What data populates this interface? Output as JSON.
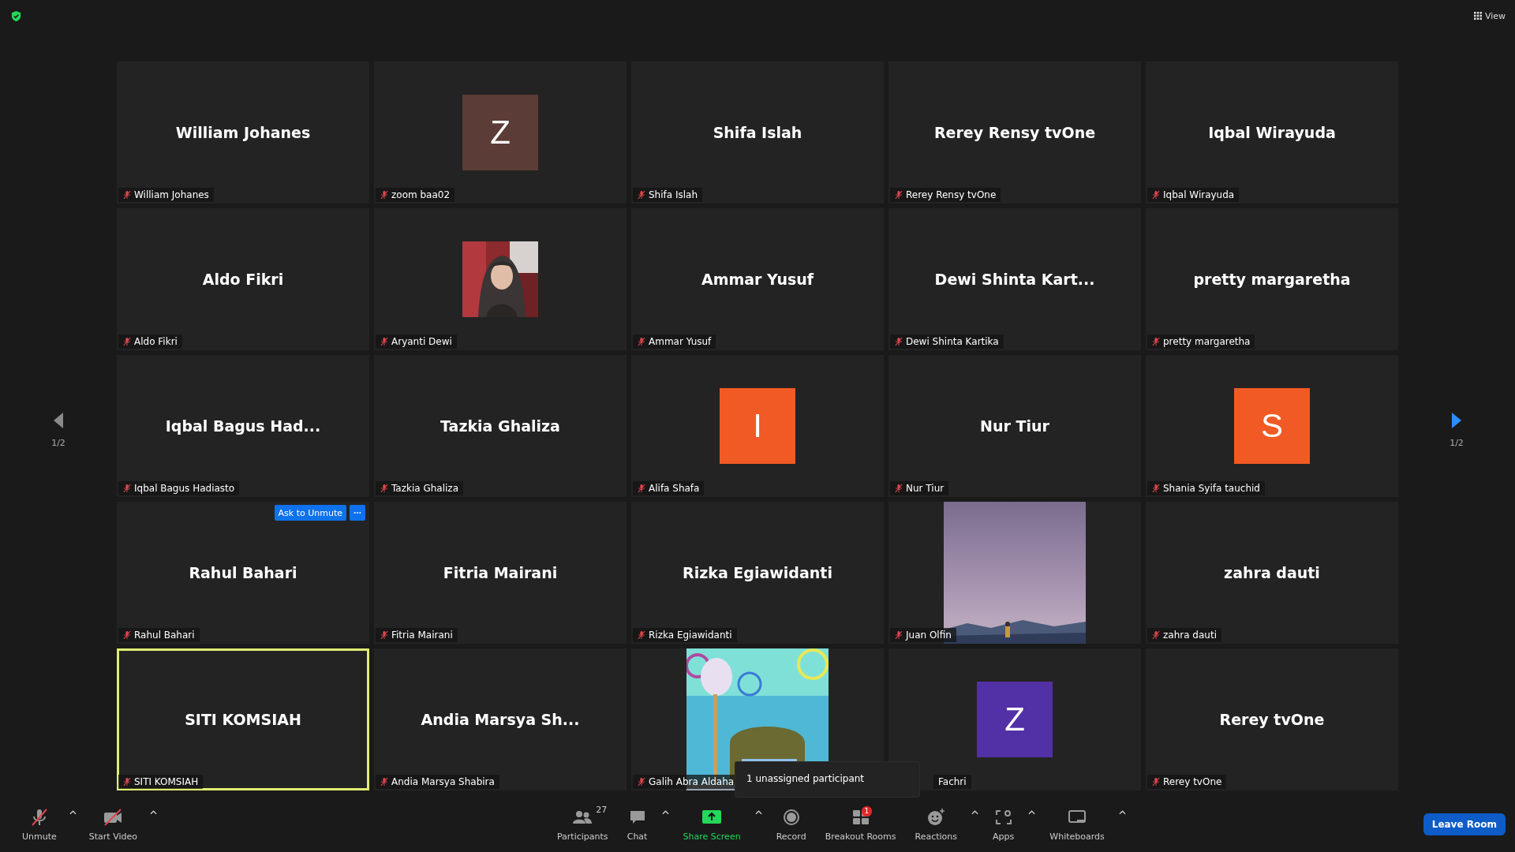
{
  "top_bar": {
    "view_label": "View"
  },
  "pager": {
    "prev": {
      "label": "1/2",
      "enabled": false
    },
    "next": {
      "label": "1/2",
      "enabled": true
    }
  },
  "tiles": [
    {
      "kind": "name",
      "title": "William Johanes",
      "tag": "William Johanes",
      "muted": true
    },
    {
      "kind": "avatar",
      "letter": "Z",
      "color": "#5c3c36",
      "tag": "zoom baa02",
      "muted": true
    },
    {
      "kind": "name",
      "title": "Shifa Islah",
      "tag": "Shifa Islah",
      "muted": true
    },
    {
      "kind": "name",
      "title": "Rerey Rensy tvOne",
      "tag": "Rerey Rensy tvOne",
      "muted": true
    },
    {
      "kind": "name",
      "title": "Iqbal Wirayuda",
      "tag": "Iqbal Wirayuda",
      "muted": true
    },
    {
      "kind": "name",
      "title": "Aldo Fikri",
      "tag": "Aldo Fikri",
      "muted": true
    },
    {
      "kind": "picture",
      "tag": "Aryanti Dewi",
      "muted": true
    },
    {
      "kind": "name",
      "title": "Ammar Yusuf",
      "tag": "Ammar Yusuf",
      "muted": true
    },
    {
      "kind": "name",
      "title": "Dewi Shinta Kart...",
      "tag": "Dewi Shinta Kartika",
      "muted": true
    },
    {
      "kind": "name",
      "title": "pretty margaretha",
      "tag": "pretty margaretha",
      "muted": true
    },
    {
      "kind": "name",
      "title": "Iqbal Bagus Had...",
      "tag": "Iqbal Bagus Hadiasto",
      "muted": true
    },
    {
      "kind": "name",
      "title": "Tazkia Ghaliza",
      "tag": "Tazkia Ghaliza",
      "muted": true
    },
    {
      "kind": "avatar",
      "letter": "I",
      "color": "#f15a24",
      "tag": "Alifa Shafa",
      "muted": true
    },
    {
      "kind": "name",
      "title": "Nur Tiur",
      "tag": "Nur Tiur",
      "muted": true
    },
    {
      "kind": "avatar",
      "letter": "S",
      "color": "#f15a24",
      "tag": "Shania Syifa tauchid",
      "muted": true
    },
    {
      "kind": "name",
      "title": "Rahul Bahari",
      "tag": "Rahul Bahari",
      "muted": true,
      "hover_actions": {
        "button": "Ask to Unmute"
      }
    },
    {
      "kind": "name",
      "title": "Fitria Mairani",
      "tag": "Fitria Mairani",
      "muted": true
    },
    {
      "kind": "name",
      "title": "Rizka Egiawidanti",
      "tag": "Rizka Egiawidanti",
      "muted": true
    },
    {
      "kind": "picture",
      "tag": "Juan Olfin",
      "muted": true
    },
    {
      "kind": "name",
      "title": "zahra dauti",
      "tag": "zahra dauti",
      "muted": true
    },
    {
      "kind": "name",
      "title": "SITI KOMSIAH",
      "tag": "SITI KOMSIAH",
      "muted": true,
      "active": true
    },
    {
      "kind": "name",
      "title": "Andia Marsya Sh...",
      "tag": "Andia Marsya Shabira",
      "muted": true
    },
    {
      "kind": "picture",
      "tag": "Galih Abra Aldaha",
      "muted": true
    },
    {
      "kind": "avatar",
      "letter": "Z",
      "color": "#5230a5",
      "tag": "Fachri"
    },
    {
      "kind": "name",
      "title": "Rerey tvOne",
      "tag": "Rerey tvOne",
      "muted": true
    }
  ],
  "tooltip": "1 unassigned participant",
  "toolbar": {
    "left": [
      {
        "kind": "mic",
        "label": "Unmute",
        "caret": true
      },
      {
        "kind": "video",
        "label": "Start Video",
        "caret": true
      }
    ],
    "center": [
      {
        "kind": "participants",
        "label": "Participants",
        "count": "27"
      },
      {
        "kind": "chat",
        "label": "Chat",
        "caret": true
      },
      {
        "kind": "share",
        "label": "Share Screen",
        "caret": true
      },
      {
        "kind": "record",
        "label": "Record"
      },
      {
        "kind": "breakout",
        "label": "Breakout Rooms",
        "badge": "1"
      },
      {
        "kind": "reactions",
        "label": "Reactions",
        "caret": true
      },
      {
        "kind": "apps",
        "label": "Apps",
        "caret": true
      },
      {
        "kind": "whiteboard",
        "label": "Whiteboards",
        "caret": true
      }
    ],
    "leave_button": "Leave Room"
  }
}
